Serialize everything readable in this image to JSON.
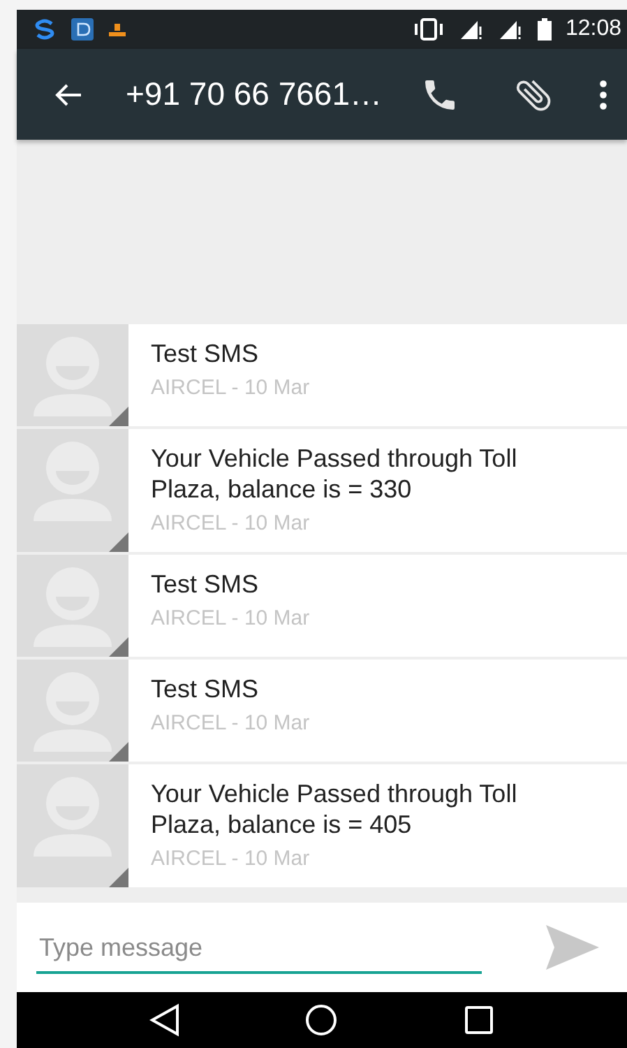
{
  "status_bar": {
    "time": "12:08"
  },
  "toolbar": {
    "title": "+91 70 66 7661…"
  },
  "messages": [
    {
      "text": "Test SMS",
      "meta": "AIRCEL - 10 Mar"
    },
    {
      "text": "Your Vehicle Passed through Toll Plaza, balance is = 330",
      "meta": "AIRCEL - 10 Mar"
    },
    {
      "text": "Test SMS",
      "meta": "AIRCEL - 10 Mar"
    },
    {
      "text": "Test SMS",
      "meta": "AIRCEL - 10 Mar"
    },
    {
      "text": "Your Vehicle Passed through Toll Plaza, balance is = 405",
      "meta": "AIRCEL - 10 Mar"
    }
  ],
  "composer": {
    "placeholder": "Type message"
  }
}
